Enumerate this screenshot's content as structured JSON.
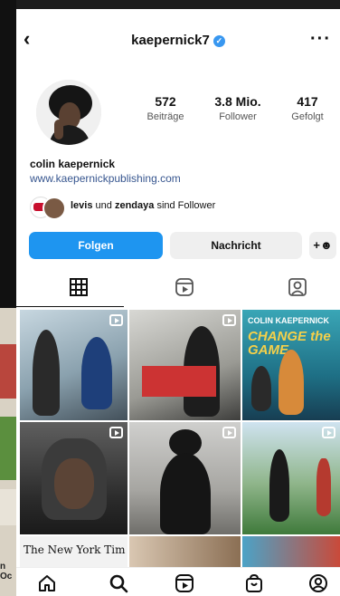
{
  "header": {
    "username": "kaepernick7"
  },
  "profile": {
    "stats": [
      {
        "value": "572",
        "label": "Beiträge"
      },
      {
        "value": "3.8 Mio.",
        "label": "Follower"
      },
      {
        "value": "417",
        "label": "Gefolgt"
      }
    ],
    "name": "colin kaepernick",
    "link": "www.kaepernickpublishing.com",
    "followed_by": {
      "user1": "levis",
      "connector": "und",
      "user2": "zendaya",
      "suffix": "sind Follower"
    }
  },
  "actions": {
    "follow": "Folgen",
    "message": "Nachricht"
  },
  "tabs": [
    "grid-icon",
    "reels-icon",
    "tagged-icon"
  ],
  "posts": [
    {
      "kind": "reel",
      "text": ""
    },
    {
      "kind": "reel",
      "text": ""
    },
    {
      "kind": "post",
      "line1": "COLIN KAEPERNICK",
      "line2": "CHANGE the GAME"
    },
    {
      "kind": "reel",
      "text": ""
    },
    {
      "kind": "reel",
      "text": ""
    },
    {
      "kind": "reel",
      "text": ""
    },
    {
      "kind": "post",
      "text": "The New York Tim"
    }
  ],
  "background_text": "n Oc",
  "colors": {
    "accent": "#1e95f0",
    "verified": "#3897f0",
    "link": "#37568f"
  },
  "bottom_nav": [
    "home-icon",
    "search-icon",
    "reels-icon",
    "shop-icon",
    "profile-icon"
  ]
}
